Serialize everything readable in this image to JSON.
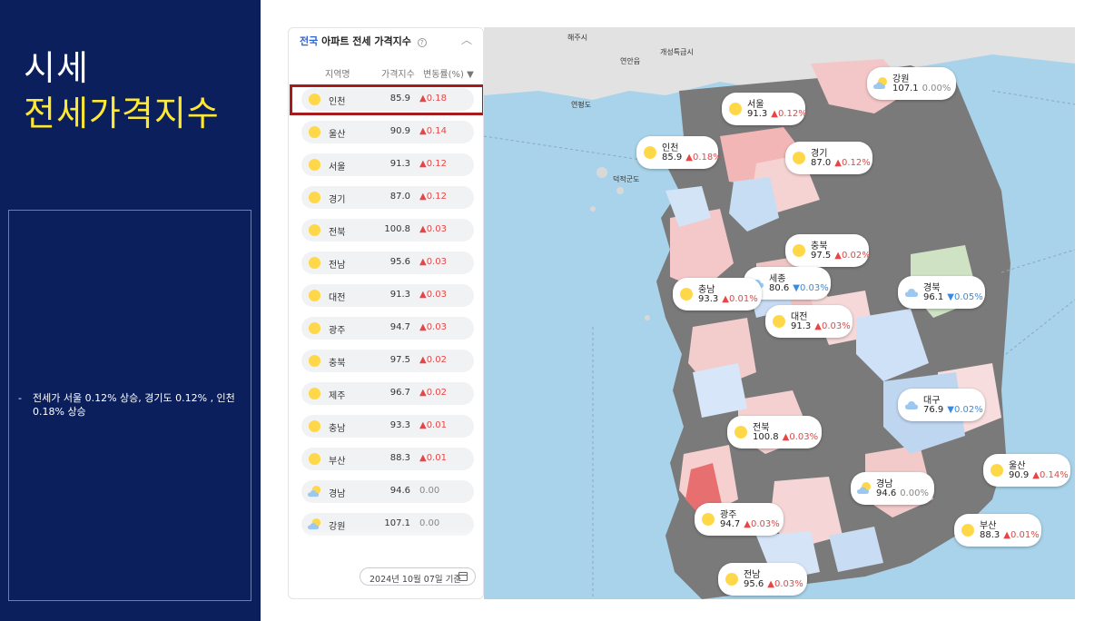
{
  "slide": {
    "title_line1": "시세",
    "title_line2": "전세가격지수",
    "note": "전세가 서울 0.12% 상승, 경기도 0.12% , 인천 0.18% 상승",
    "note_dash": "-"
  },
  "panel": {
    "header_prefix": "전국",
    "header_title": "아파트 전세 가격지수",
    "help_icon": "?",
    "collapse_icon": "︿",
    "col_region": "지역명",
    "col_index": "가격지수",
    "col_change": "변동률(%) ▼",
    "date_label": "2024년 10월 07일 기준",
    "rows": [
      {
        "name": "인천",
        "value": "85.9",
        "change": "▲0.18",
        "dir": "up",
        "weather": "sun"
      },
      {
        "name": "울산",
        "value": "90.9",
        "change": "▲0.14",
        "dir": "up",
        "weather": "sun"
      },
      {
        "name": "서울",
        "value": "91.3",
        "change": "▲0.12",
        "dir": "up",
        "weather": "sun"
      },
      {
        "name": "경기",
        "value": "87.0",
        "change": "▲0.12",
        "dir": "up",
        "weather": "sun"
      },
      {
        "name": "전북",
        "value": "100.8",
        "change": "▲0.03",
        "dir": "up",
        "weather": "sun"
      },
      {
        "name": "전남",
        "value": "95.6",
        "change": "▲0.03",
        "dir": "up",
        "weather": "sun"
      },
      {
        "name": "대전",
        "value": "91.3",
        "change": "▲0.03",
        "dir": "up",
        "weather": "sun"
      },
      {
        "name": "광주",
        "value": "94.7",
        "change": "▲0.03",
        "dir": "up",
        "weather": "sun"
      },
      {
        "name": "충북",
        "value": "97.5",
        "change": "▲0.02",
        "dir": "up",
        "weather": "sun"
      },
      {
        "name": "제주",
        "value": "96.7",
        "change": "▲0.02",
        "dir": "up",
        "weather": "sun"
      },
      {
        "name": "충남",
        "value": "93.3",
        "change": "▲0.01",
        "dir": "up",
        "weather": "sun"
      },
      {
        "name": "부산",
        "value": "88.3",
        "change": "▲0.01",
        "dir": "up",
        "weather": "sun"
      },
      {
        "name": "경남",
        "value": "94.6",
        "change": "0.00",
        "dir": "flat",
        "weather": "partly-cloudy"
      },
      {
        "name": "강원",
        "value": "107.1",
        "change": "0.00",
        "dir": "flat",
        "weather": "partly-cloudy"
      }
    ]
  },
  "map": {
    "places": [
      {
        "label": "해주시"
      },
      {
        "label": "연안읍"
      },
      {
        "label": "개성특급시"
      },
      {
        "label": "연평도"
      },
      {
        "label": "덕적군도"
      }
    ],
    "bubbles": [
      {
        "name": "강원",
        "value": "107.1",
        "change": "0.00%",
        "dir": "flat",
        "weather": "partly-cloudy"
      },
      {
        "name": "서울",
        "value": "91.3",
        "change": "▲0.12%",
        "dir": "up",
        "weather": "sun"
      },
      {
        "name": "인천",
        "value": "85.9",
        "change": "▲0.18%",
        "dir": "up",
        "weather": "sun"
      },
      {
        "name": "경기",
        "value": "87.0",
        "change": "▲0.12%",
        "dir": "up",
        "weather": "sun"
      },
      {
        "name": "충북",
        "value": "97.5",
        "change": "▲0.02%",
        "dir": "up",
        "weather": "sun"
      },
      {
        "name": "세종",
        "value": "80.6",
        "change": "▼0.03%",
        "dir": "dn",
        "weather": "cloud"
      },
      {
        "name": "충남",
        "value": "93.3",
        "change": "▲0.01%",
        "dir": "up",
        "weather": "sun"
      },
      {
        "name": "경북",
        "value": "96.1",
        "change": "▼0.05%",
        "dir": "dn",
        "weather": "cloud"
      },
      {
        "name": "대전",
        "value": "91.3",
        "change": "▲0.03%",
        "dir": "up",
        "weather": "sun"
      },
      {
        "name": "대구",
        "value": "76.9",
        "change": "▼0.02%",
        "dir": "dn",
        "weather": "cloud"
      },
      {
        "name": "전북",
        "value": "100.8",
        "change": "▲0.03%",
        "dir": "up",
        "weather": "sun"
      },
      {
        "name": "울산",
        "value": "90.9",
        "change": "▲0.14%",
        "dir": "up",
        "weather": "sun"
      },
      {
        "name": "경남",
        "value": "94.6",
        "change": "0.00%",
        "dir": "flat",
        "weather": "partly-cloudy"
      },
      {
        "name": "광주",
        "value": "94.7",
        "change": "▲0.03%",
        "dir": "up",
        "weather": "sun"
      },
      {
        "name": "부산",
        "value": "88.3",
        "change": "▲0.01%",
        "dir": "up",
        "weather": "sun"
      },
      {
        "name": "전남",
        "value": "95.6",
        "change": "▲0.03%",
        "dir": "up",
        "weather": "sun"
      }
    ]
  },
  "colors": {
    "navy": "#0b1f5c",
    "accent_yellow": "#ffe833",
    "up_red": "#e54747",
    "down_blue": "#3a8be0",
    "highlight_red": "#a61c1c"
  }
}
